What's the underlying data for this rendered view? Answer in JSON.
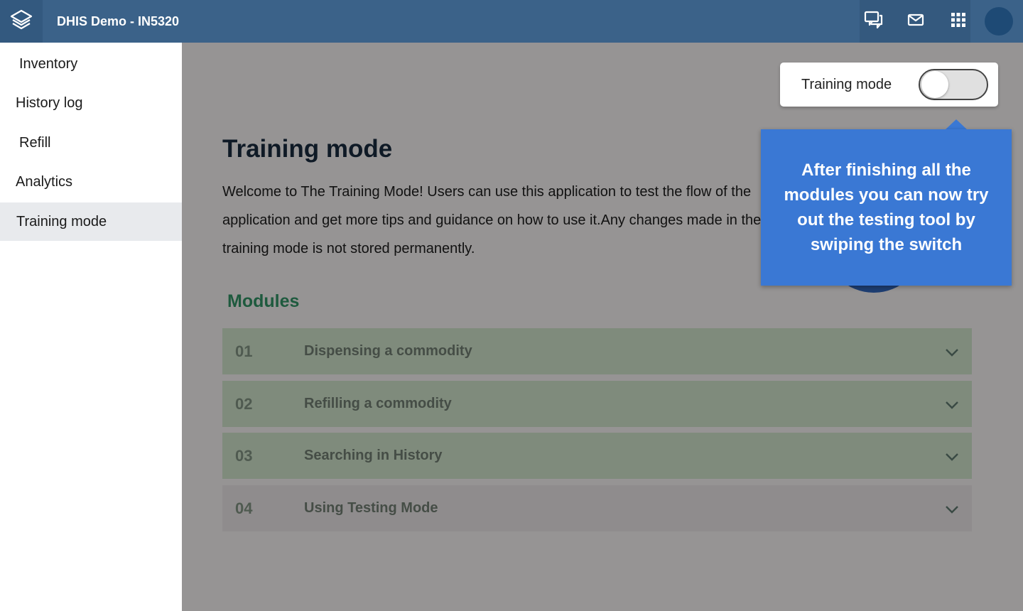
{
  "header": {
    "app_title": "DHIS Demo - IN5320",
    "logo_icon": "layers-icon",
    "icons": [
      "interpretations-icon",
      "messages-icon",
      "apps-grid-icon"
    ],
    "profile": "profile-avatar"
  },
  "sidebar": {
    "items": [
      {
        "label": "Inventory"
      },
      {
        "label": "History log"
      },
      {
        "label": "Refill"
      },
      {
        "label": "Analytics"
      },
      {
        "label": "Training mode",
        "active": true
      }
    ]
  },
  "main": {
    "title": "Training mode",
    "description": "Welcome to The Training Mode! Users can use this application to test the flow of the application and get more tips and guidance on how to use it.Any changes made in the training mode is not stored permanently.",
    "modules_title": "Modules",
    "modules": [
      {
        "num": "01",
        "title": "Dispensing a commodity",
        "color": "#7f8b7c"
      },
      {
        "num": "02",
        "title": "Refilling a commodity",
        "color": "#7f8b7c"
      },
      {
        "num": "03",
        "title": "Searching in History",
        "color": "#7f8b7c"
      },
      {
        "num": "04",
        "title": "Using Testing Mode",
        "color": "#8f8c8d"
      }
    ]
  },
  "toggle": {
    "label": "Training mode",
    "on": false
  },
  "tooltip": {
    "text": "After finishing all the modules you can now try out the testing tool by swiping the switch"
  },
  "colors": {
    "header": "#3b6289",
    "overlay": "#969494",
    "tooltip": "#3a78d4",
    "modules_heading": "#1e5a3e"
  }
}
